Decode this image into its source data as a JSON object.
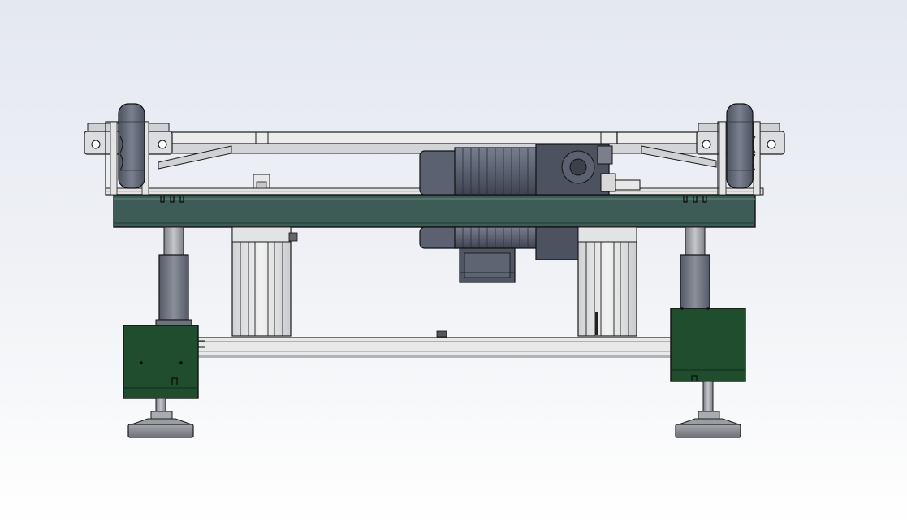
{
  "scene": {
    "view": "cad-front-elevation",
    "object": "conveyor-frame-assembly",
    "background": {
      "top": "#e4e8f0",
      "bottom": "#ffffff"
    },
    "colors": {
      "steel": "#e6e6e6",
      "steel_shadow": "#b9bcc0",
      "outline": "#1c1c1c",
      "green_beam": "#3d5c55",
      "green_box": "#1f4d2e",
      "motor": "#5b6170",
      "motor_dark": "#444955",
      "wheel": "#636a78",
      "foot_pad": "#8a8d92",
      "rod": "#9a9da2"
    },
    "components": [
      "top-rail",
      "left-wheel",
      "right-wheel",
      "drive-motor",
      "green-cross-beam",
      "left-leg",
      "right-leg",
      "left-lift-cylinder",
      "right-lift-cylinder",
      "lower-crossbar",
      "left-green-housing",
      "right-green-housing",
      "left-leveling-foot",
      "right-leveling-foot"
    ]
  }
}
